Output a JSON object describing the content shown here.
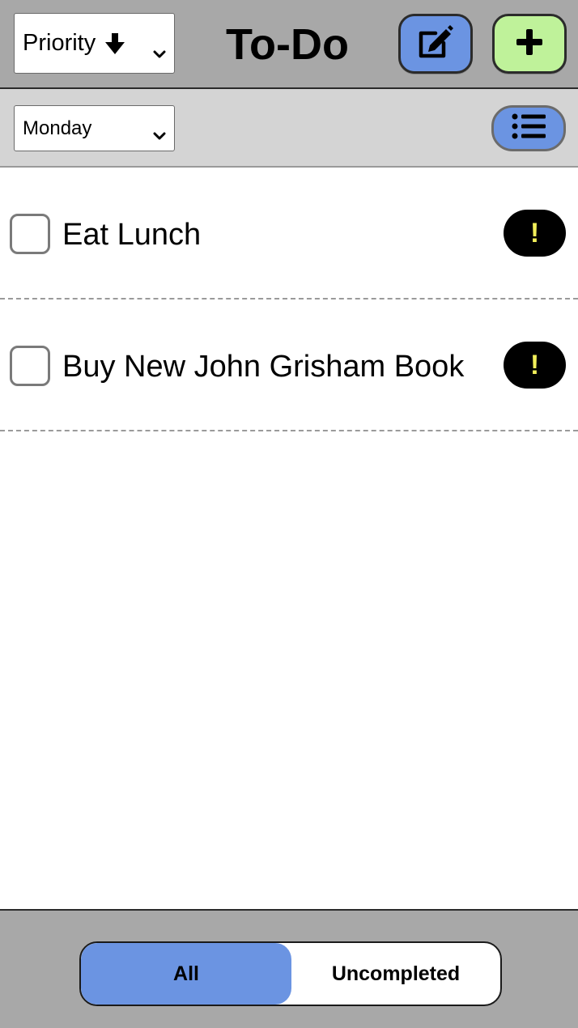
{
  "header": {
    "title": "To-Do",
    "sort_select": {
      "value": "Priority",
      "icon": "arrow-down-icon"
    },
    "edit_button": {
      "icon": "edit-icon",
      "color": "#6b94e2"
    },
    "add_button": {
      "icon": "plus-icon",
      "color": "#bff29a"
    }
  },
  "filter": {
    "day_select": {
      "value": "Monday"
    },
    "list_button": {
      "icon": "list-icon",
      "color": "#6b94e2"
    }
  },
  "tasks": [
    {
      "label": "Eat Lunch",
      "checked": false,
      "priority_badge": "!"
    },
    {
      "label": "Buy New John Grisham Book",
      "checked": false,
      "priority_badge": "!"
    }
  ],
  "footer": {
    "tabs": [
      {
        "label": "All",
        "active": true
      },
      {
        "label": "Uncompleted",
        "active": false
      }
    ],
    "accent_color": "#6b94e2"
  }
}
